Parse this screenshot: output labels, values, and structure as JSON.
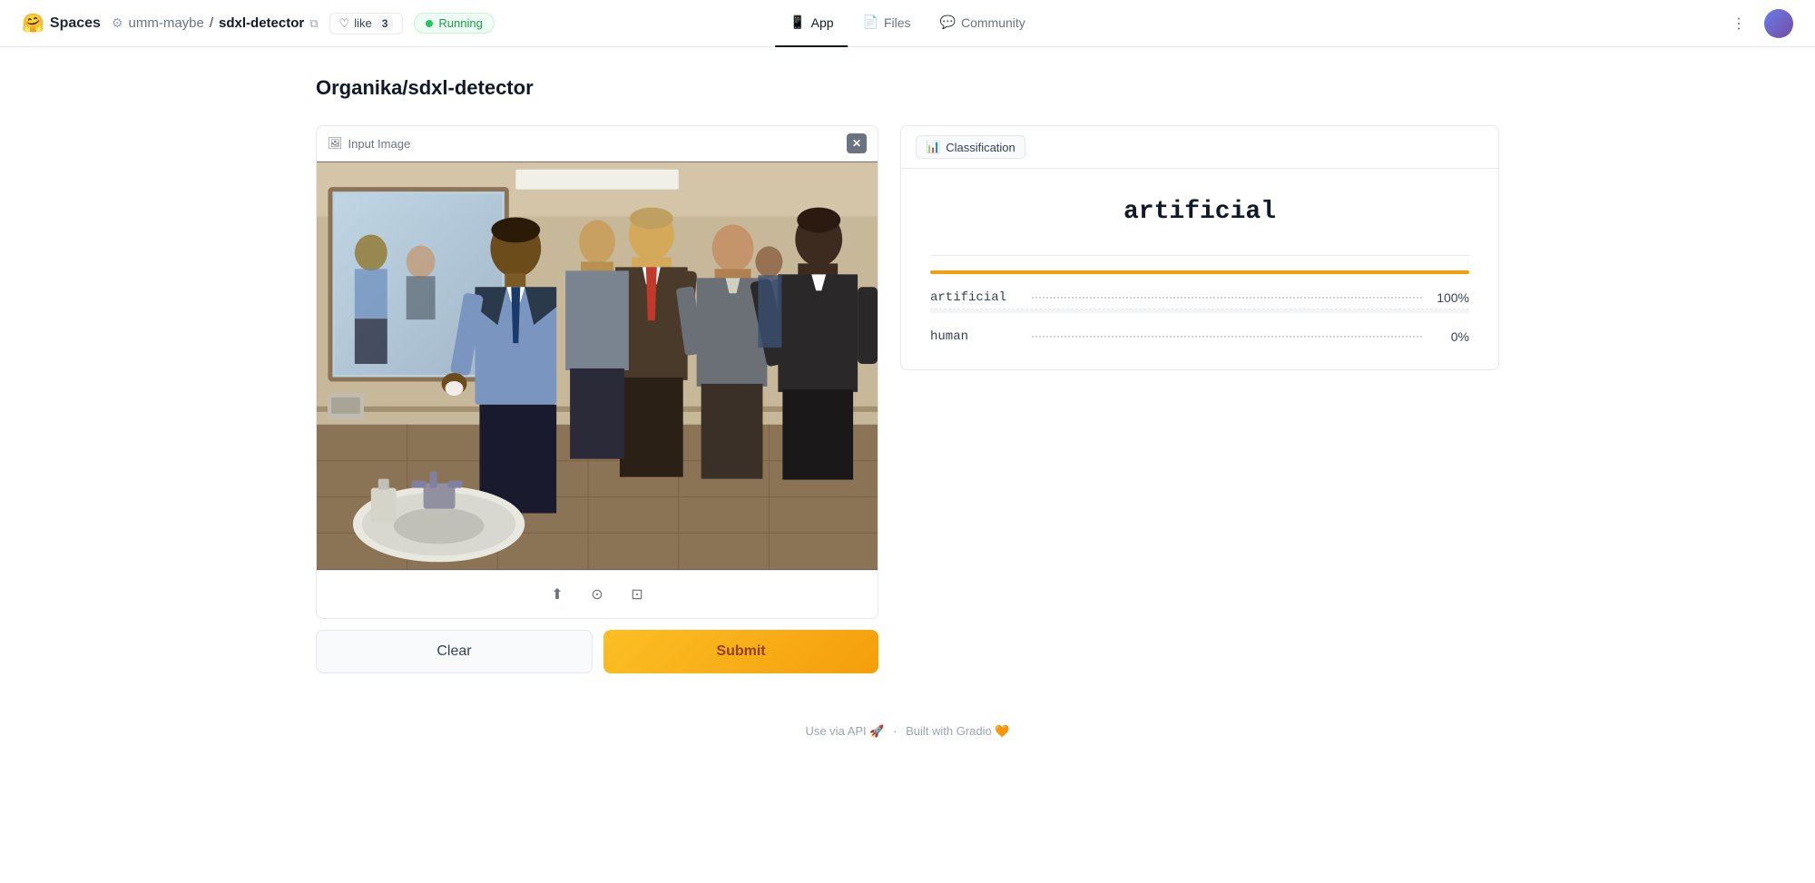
{
  "header": {
    "spaces_label": "Spaces",
    "spaces_emoji": "🤗",
    "repo_owner": "umm-maybe",
    "repo_separator": "/",
    "repo_name": "sdxl-detector",
    "like_label": "like",
    "like_count": "3",
    "running_label": "Running",
    "nav": [
      {
        "id": "app",
        "label": "App",
        "active": true,
        "icon": "📱"
      },
      {
        "id": "files",
        "label": "Files",
        "active": false,
        "icon": "📄"
      },
      {
        "id": "community",
        "label": "Community",
        "active": false,
        "icon": "💬"
      }
    ]
  },
  "page": {
    "title": "Organika/sdxl-detector"
  },
  "input_panel": {
    "label": "Input Image",
    "toolbar": {
      "upload_icon": "⬆",
      "webcam_icon": "⊙",
      "clipboard_icon": "⊡"
    },
    "clear_button": "Clear",
    "submit_button": "Submit"
  },
  "output_panel": {
    "tab_label": "Classification",
    "result": "artificial",
    "bars": [
      {
        "label": "artificial",
        "pct": 100,
        "pct_label": "100%",
        "color": "#f59e0b"
      },
      {
        "label": "human",
        "pct": 0,
        "pct_label": "0%",
        "color": "#f59e0b"
      }
    ]
  },
  "footer": {
    "api_label": "Use via API",
    "api_icon": "🚀",
    "separator": "·",
    "gradio_label": "Built with Gradio",
    "gradio_icon": "🧡"
  }
}
